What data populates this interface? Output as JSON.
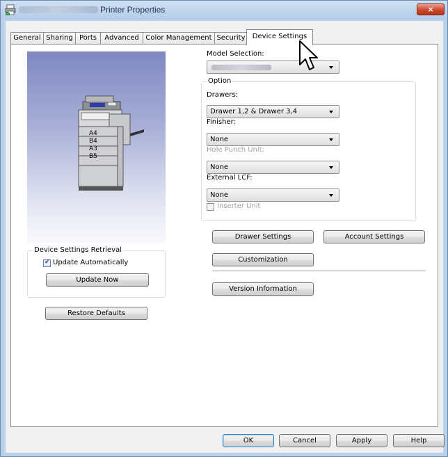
{
  "window": {
    "title": "Printer Properties",
    "close_glyph": "×"
  },
  "tabs": [
    {
      "label": "General"
    },
    {
      "label": "Sharing"
    },
    {
      "label": "Ports"
    },
    {
      "label": "Advanced"
    },
    {
      "label": "Color Management"
    },
    {
      "label": "Security"
    },
    {
      "label": "Device Settings"
    }
  ],
  "active_tab": "Device Settings",
  "preview": {
    "paper_labels": [
      "A4",
      "B4",
      "A3",
      "B5"
    ]
  },
  "model_selection": {
    "label": "Model Selection:"
  },
  "option_group": {
    "title": "Option",
    "drawers": {
      "label": "Drawers:",
      "value": "Drawer 1,2 & Drawer 3,4"
    },
    "finisher": {
      "label": "Finisher:",
      "value": "None"
    },
    "hole_punch": {
      "label": "Hole Punch Unit:",
      "value": "None"
    },
    "external_lcf": {
      "label": "External LCF:",
      "value": "None"
    },
    "inserter": {
      "label": "Inserter Unit",
      "checked": false
    }
  },
  "retrieval_group": {
    "title": "Device Settings Retrieval",
    "update_auto_label": "Update Automatically",
    "update_auto_checked": true,
    "update_now_label": "Update Now"
  },
  "buttons": {
    "restore_defaults": "Restore Defaults",
    "drawer_settings": "Drawer Settings",
    "account_settings": "Account Settings",
    "customization": "Customization",
    "version_information": "Version Information"
  },
  "footer": {
    "ok": "OK",
    "cancel": "Cancel",
    "apply": "Apply",
    "help": "Help"
  }
}
